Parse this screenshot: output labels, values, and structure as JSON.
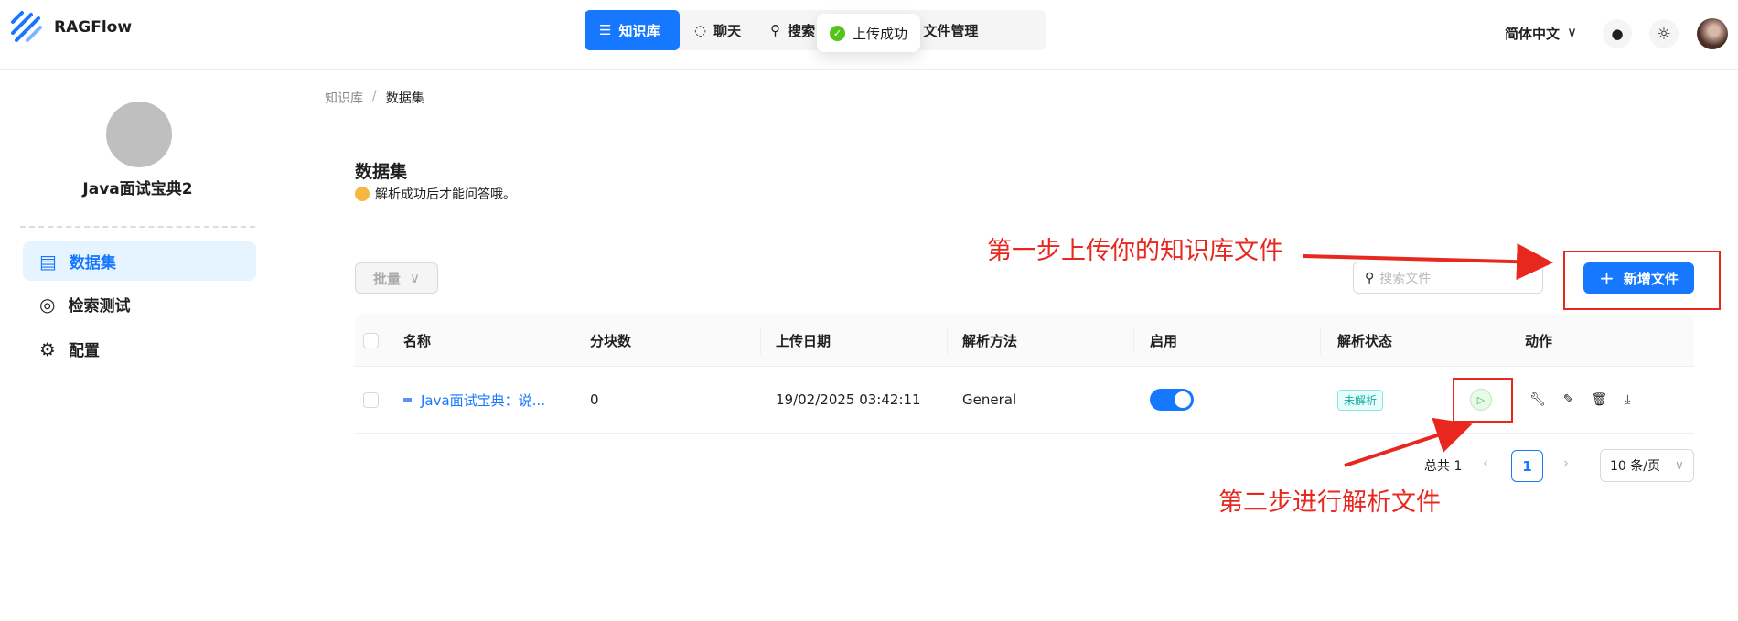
{
  "app": {
    "name": "RAGFlow"
  },
  "nav": [
    {
      "label": "知识库",
      "icon": "database-icon",
      "active": true
    },
    {
      "label": "聊天",
      "icon": "chat-icon"
    },
    {
      "label": "搜索",
      "icon": "search-icon"
    },
    {
      "label": "文件管理",
      "icon": "folder-icon"
    }
  ],
  "toast": {
    "text": "上传成功",
    "icon": "check-circle-icon"
  },
  "header": {
    "language": "简体中文"
  },
  "sidebar": {
    "kb_name": "Java面试宝典2",
    "items": [
      {
        "label": "数据集",
        "icon": "file-icon",
        "active": true
      },
      {
        "label": "检索测试",
        "icon": "target-icon"
      },
      {
        "label": "配置",
        "icon": "gear-icon"
      }
    ]
  },
  "breadcrumb": {
    "parent": "知识库",
    "sep": "/",
    "current": "数据集"
  },
  "page": {
    "title": "数据集",
    "subtitle": "解析成功后才能问答哦。"
  },
  "toolbar": {
    "bulk": "批量",
    "search_placeholder": "搜索文件",
    "add": "新增文件"
  },
  "table": {
    "columns": [
      "名称",
      "分块数",
      "上传日期",
      "解析方法",
      "启用",
      "解析状态",
      "动作"
    ],
    "rows": [
      {
        "name": "Java面试宝典：说...",
        "chunks": "0",
        "date": "19/02/2025 03:42:11",
        "method": "General",
        "enabled": true,
        "status": "未解析"
      }
    ]
  },
  "pagination": {
    "total": "总共 1",
    "page": "1",
    "page_size": "10 条/页"
  },
  "annotations": {
    "step1": "第一步上传你的知识库文件",
    "step2": "第二步进行解析文件"
  },
  "colors": {
    "accent": "#1677ff",
    "annotation": "#e8281f",
    "success": "#52c41a"
  }
}
